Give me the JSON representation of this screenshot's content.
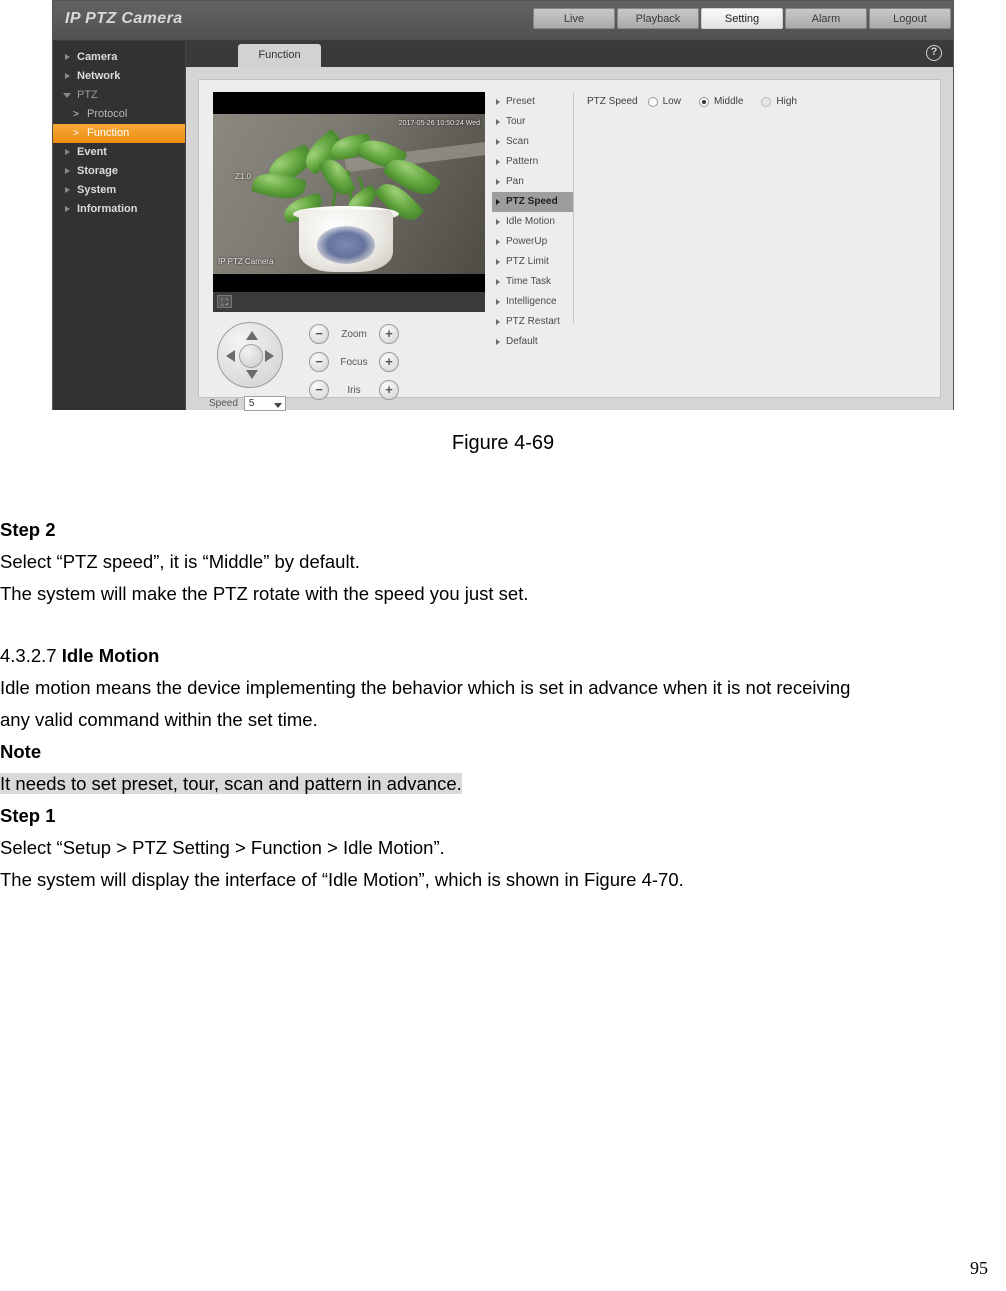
{
  "screenshot": {
    "brand": "IP PTZ Camera",
    "topnav": [
      {
        "label": "Live",
        "active": false
      },
      {
        "label": "Playback",
        "active": false
      },
      {
        "label": "Setting",
        "active": true
      },
      {
        "label": "Alarm",
        "active": false
      },
      {
        "label": "Logout",
        "active": false
      }
    ],
    "sidebar": [
      {
        "label": "Camera",
        "type": "group"
      },
      {
        "label": "Network",
        "type": "group"
      },
      {
        "label": "PTZ",
        "type": "group-open"
      },
      {
        "label": "Protocol",
        "type": "sub"
      },
      {
        "label": "Function",
        "type": "sub-selected"
      },
      {
        "label": "Event",
        "type": "group"
      },
      {
        "label": "Storage",
        "type": "group"
      },
      {
        "label": "System",
        "type": "group"
      },
      {
        "label": "Information",
        "type": "group"
      }
    ],
    "tab": "Function",
    "help_icon": "?",
    "video": {
      "osd_time": "2017-05-26 10:50:24 Wed",
      "osd_zoom": "Z1.0",
      "osd_name": "IP PTZ Camera",
      "expand_icon": "expand-icon"
    },
    "function_menu": [
      "Preset",
      "Tour",
      "Scan",
      "Pattern",
      "Pan",
      "PTZ Speed",
      "Idle Motion",
      "PowerUp",
      "PTZ Limit",
      "Time Task",
      "Intelligence",
      "PTZ Restart",
      "Default"
    ],
    "function_menu_selected": "PTZ Speed",
    "settings": {
      "ptz_speed_label": "PTZ Speed",
      "options": [
        {
          "label": "Low",
          "selected": false
        },
        {
          "label": "Middle",
          "selected": true
        },
        {
          "label": "High",
          "selected": false
        }
      ]
    },
    "ptz_control": {
      "speed_label": "Speed",
      "speed_value": "5",
      "minus": "−",
      "plus": "+",
      "rows": [
        "Zoom",
        "Focus",
        "Iris"
      ]
    },
    "colors": {
      "accent": "#ef8c13",
      "sidebar_bg": "#323232",
      "panel_bg": "#ededed",
      "selected_item_bg": "#9d9d9d"
    }
  },
  "document": {
    "figure_caption": "Figure 4-69",
    "step2_title": "Step 2",
    "step2_line1": "Select “PTZ speed”, it is “Middle” by default.",
    "step2_line2": "The system will make the PTZ rotate with the speed you just set.",
    "section_number": "4.3.2.7 ",
    "section_title": "Idle Motion",
    "body_line1": "Idle motion means the device implementing the behavior which is set in advance when it is not receiving",
    "body_line2": "any valid command within the set time.",
    "note_title": "Note",
    "note_text": "It needs to set preset, tour, scan and pattern in advance.",
    "step1_title": "Step 1",
    "step1_line1": "Select “Setup > PTZ Setting > Function > Idle Motion”.",
    "step1_line2": "The system will display the interface of “Idle Motion”, which is shown in Figure 4-70.",
    "page_number": "95"
  }
}
